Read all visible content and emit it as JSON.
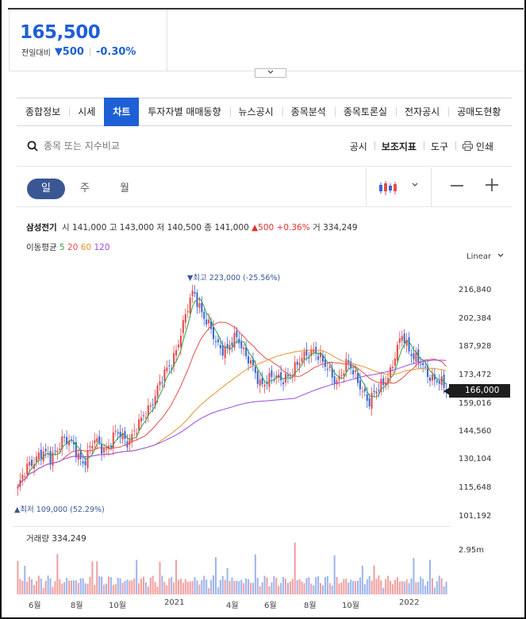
{
  "quote": {
    "price": "165,500",
    "change_label": "전일대비",
    "change_amount": "▼500",
    "change_percent": "-0.30%"
  },
  "toggle_icon": "chevron-down-icon",
  "tabs": [
    {
      "label": "종합정보"
    },
    {
      "label": "시세"
    },
    {
      "label": "차트"
    },
    {
      "label": "투자자별 매매동향"
    },
    {
      "label": "뉴스공시"
    },
    {
      "label": "종목분석"
    },
    {
      "label": "종목토론실"
    },
    {
      "label": "전자공시"
    },
    {
      "label": "공매도현황"
    }
  ],
  "active_tab": "차트",
  "search": {
    "placeholder": "종목 또는 지수비교"
  },
  "tools": {
    "disclosure": "공시",
    "indicators": "보조지표",
    "tools": "도구",
    "print": "인쇄"
  },
  "periods": {
    "day": "일",
    "week": "주",
    "month": "월"
  },
  "active_period": "일",
  "stock_info": {
    "name": "삼성전기",
    "open_label": "시",
    "open": "141,000",
    "high_label": "고",
    "high": "143,000",
    "low_label": "저",
    "low": "140,500",
    "close_label": "종",
    "close": "141,000",
    "change": "▲500 +0.36%",
    "volume_label": "거",
    "volume": "334,249"
  },
  "moving_average": {
    "label": "이동평균",
    "periods": [
      "5",
      "20",
      "60",
      "120"
    ],
    "colors": [
      "#2e9e48",
      "#e84b4b",
      "#e8922c",
      "#9a4de0"
    ]
  },
  "scale_mode": "Linear",
  "chart_data": {
    "type": "candlestick",
    "y_ticks": [
      "216,840",
      "202,384",
      "187,928",
      "173,472",
      "159,016",
      "144,560",
      "130,104",
      "115,648",
      "101,192"
    ],
    "y_range": [
      101192,
      216840
    ],
    "current_price": "166,000",
    "high_annotation": "▼최고 223,000 (-25.56%)",
    "low_annotation": "▲최저 109,000 (52.29%)",
    "x_labels": [
      "6월",
      "8월",
      "10월",
      "2021",
      "4월",
      "6월",
      "8월",
      "10월",
      "2022"
    ],
    "volume_label": "거래량",
    "volume_value": "334,249",
    "volume_max": "2.95m",
    "up_color": "#e84b4b",
    "down_color": "#3a66d6",
    "close_path": [
      112000,
      125000,
      132000,
      128000,
      140000,
      135000,
      127000,
      138000,
      134000,
      142000,
      139000,
      146000,
      158000,
      170000,
      182000,
      200000,
      222000,
      205000,
      193000,
      188000,
      195000,
      184000,
      168000,
      175000,
      170000,
      178000,
      183000,
      190000,
      178000,
      172000,
      180000,
      172000,
      158000,
      170000,
      176000,
      198000,
      184000,
      178000,
      172000,
      166000
    ]
  }
}
